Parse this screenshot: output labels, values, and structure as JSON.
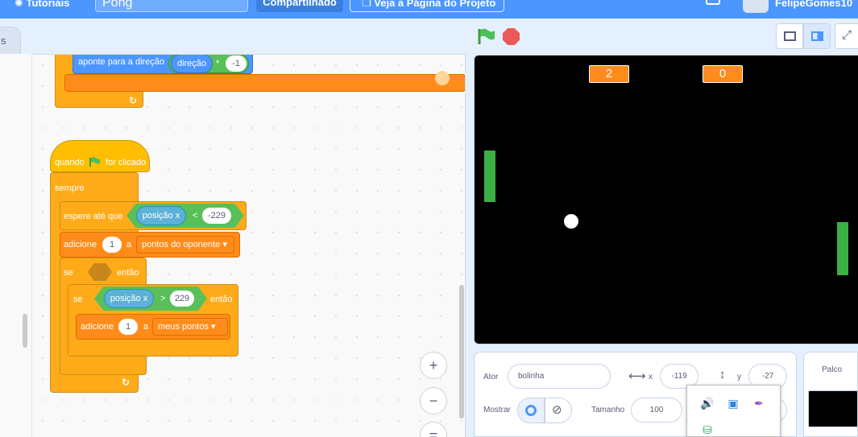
{
  "menubar": {
    "tutorials": "Tutoriais",
    "project_title": "Pong",
    "share": "Compartilhado",
    "see_project": "Veja a Página do Projeto",
    "username": "FelipeGomes10"
  },
  "tabs": {
    "costumes_partial": "s"
  },
  "blocks": {
    "point_direction": {
      "label": "aponte para a direção",
      "reporter": "direção",
      "op": "*",
      "value": "-1"
    },
    "hat": {
      "when": "quando",
      "clicked": "for clicado"
    },
    "forever": "sempre",
    "wait_until": {
      "label": "espere até que",
      "reporter": "posição x",
      "op": "<",
      "value": "-229"
    },
    "change_opponent": {
      "label": "adicione",
      "value": "1",
      "a": "a",
      "variable": "pontos do oponente"
    },
    "if_outer": {
      "se": "se",
      "entao": "então"
    },
    "if_inner": {
      "se": "se",
      "reporter": "posição x",
      "op": ">",
      "value": "229",
      "entao": "então"
    },
    "change_mine": {
      "label": "adicione",
      "value": "1",
      "a": "a",
      "variable": "meus pontos"
    }
  },
  "zoom": {
    "in": "+",
    "out": "−",
    "reset": "="
  },
  "stage": {
    "score_left": "2",
    "score_right": "0",
    "colors": {
      "background": "#000000",
      "paddle": "#3cb043",
      "score": "#ff8c1a"
    }
  },
  "sprite_info": {
    "sprite_label": "Ator",
    "sprite_name": "bolinha",
    "x_label": "x",
    "x_value": "-119",
    "y_label": "y",
    "y_value": "-27",
    "show_label": "Mostrar",
    "size_label": "Tamanho",
    "size_value": "100"
  },
  "stage_pane": {
    "label": "Palco"
  },
  "icons": [
    "lightbulb-icon",
    "folder-icon",
    "green-flag-icon",
    "stop-icon",
    "small-stage-icon",
    "normal-stage-icon",
    "fullscreen-icon",
    "eye-icon",
    "eye-off-icon",
    "zoom-in-icon",
    "zoom-out-icon",
    "speaker-icon",
    "network-icon",
    "pen-icon",
    "usb-icon"
  ]
}
